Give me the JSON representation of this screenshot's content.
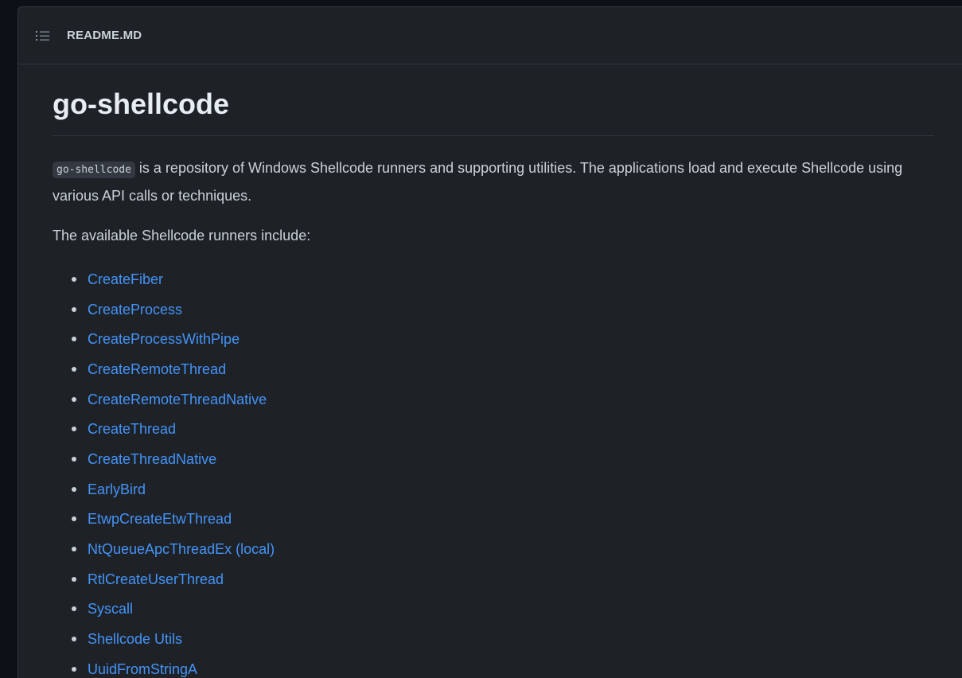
{
  "header": {
    "icon": "list-unordered-icon",
    "title": "README.MD"
  },
  "readme": {
    "title": "go-shellcode",
    "intro_code": "go-shellcode",
    "intro_text": " is a repository of Windows Shellcode runners and supporting utilities. The applications load and execute Shellcode using various API calls or techniques.",
    "lead": "The available Shellcode runners include:",
    "runners": [
      "CreateFiber",
      "CreateProcess",
      "CreateProcessWithPipe",
      "CreateRemoteThread",
      "CreateRemoteThreadNative",
      "CreateThread",
      "CreateThreadNative",
      "EarlyBird",
      "EtwpCreateEtwThread",
      "NtQueueApcThreadEx (local)",
      "RtlCreateUserThread",
      "Syscall",
      "Shellcode Utils",
      "UuidFromStringA"
    ]
  },
  "colors": {
    "background": "#1e2227",
    "link": "#4493f8",
    "text": "#c9d1d9",
    "border": "#30363d"
  }
}
